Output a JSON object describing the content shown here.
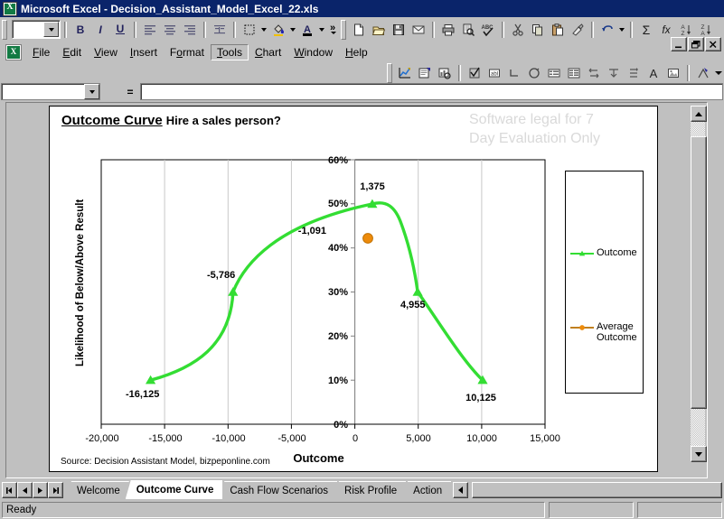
{
  "window": {
    "title": "Microsoft Excel - Decision_Assistant_Model_Excel_22.xls",
    "app_icon": "excel-logo-icon",
    "minimize_label": "_",
    "restore_label": "❐",
    "close_label": "✕"
  },
  "menu": {
    "items": [
      {
        "label": "File",
        "key": "F"
      },
      {
        "label": "Edit",
        "key": "E"
      },
      {
        "label": "View",
        "key": "V"
      },
      {
        "label": "Insert",
        "key": "I"
      },
      {
        "label": "Format",
        "key": "o"
      },
      {
        "label": "Tools",
        "key": "T",
        "selected": true
      },
      {
        "label": "Chart",
        "key": "C"
      },
      {
        "label": "Window",
        "key": "W"
      },
      {
        "label": "Help",
        "key": "H"
      }
    ]
  },
  "formatting_toolbar": {
    "font_size_value": "",
    "buttons": [
      "bold",
      "italic",
      "underline",
      "align-left",
      "align-center",
      "align-right",
      "merge-center",
      "borders",
      "fill-color",
      "font-color",
      "more-buttons"
    ]
  },
  "standard_toolbar": {
    "buttons": [
      "new",
      "open",
      "save",
      "email",
      "print",
      "print-preview",
      "spelling",
      "cut",
      "copy",
      "paste",
      "format-painter",
      "undo",
      "autosum",
      "paste-function",
      "sort-ascending",
      "sort-descending",
      "more-buttons"
    ]
  },
  "chart_toolbar": {
    "buttons": [
      "chart-objects",
      "format-object",
      "chart-type",
      "check-box",
      "text-box",
      "option-button",
      "list-box",
      "combo-box",
      "group-box",
      "scroll-bar",
      "spinner",
      "label",
      "image",
      "drawing",
      "more-buttons"
    ]
  },
  "formula_bar": {
    "name_box_value": "",
    "equals_label": "=",
    "formula_value": ""
  },
  "chart": {
    "title_main": "Outcome Curve",
    "title_sub": "Hire a sales person?",
    "watermark_line1": "Software legal for 7",
    "watermark_line2": "Day Evaluation Only",
    "source": "Source: Decision Assistant Model, bizpeponline.com",
    "legend_items": [
      {
        "label": "Outcome",
        "color": "#33DD33",
        "marker": "triangle"
      },
      {
        "label": "Average Outcome",
        "color": "#ED8B0B",
        "marker": "circle"
      }
    ]
  },
  "chart_data": {
    "type": "line",
    "title": "Outcome Curve  Hire a sales person?",
    "xlabel": "Outcome",
    "ylabel": "Likelihood of Below/Above Result",
    "xlim": [
      -20000,
      15000
    ],
    "ylim": [
      0,
      0.6
    ],
    "xticks": [
      -20000,
      -15000,
      -10000,
      -5000,
      0,
      5000,
      10000,
      15000
    ],
    "xticklabels": [
      "-20,000",
      "-15,000",
      "-10,000",
      "-5,000",
      "0",
      "5,000",
      "10,000",
      "15,000"
    ],
    "yticks": [
      0,
      0.1,
      0.2,
      0.3,
      0.4,
      0.5,
      0.6
    ],
    "yticklabels": [
      "0%",
      "10%",
      "20%",
      "30%",
      "40%",
      "50%",
      "60%"
    ],
    "grid": "vertical",
    "legend_position": "right",
    "series": [
      {
        "name": "Outcome",
        "color": "#33DD33",
        "marker": "triangle",
        "x": [
          -16125,
          -5786,
          1375,
          4955,
          10125
        ],
        "y": [
          0.1,
          0.3,
          0.5,
          0.3,
          0.1
        ],
        "point_labels": [
          "-16,125",
          "-5,786",
          "1,375",
          "4,955",
          "10,125"
        ]
      },
      {
        "name": "Average Outcome",
        "color": "#ED8B0B",
        "marker": "circle",
        "x": [
          -1091
        ],
        "y": [
          0.425
        ],
        "point_labels": [
          "-1,091"
        ]
      }
    ]
  },
  "sheet_tabs": {
    "first_label": "◀❙",
    "prev_label": "◀",
    "next_label": "▶",
    "last_label": "❙▶",
    "items": [
      {
        "label": "Welcome",
        "active": false
      },
      {
        "label": "Outcome Curve",
        "active": true
      },
      {
        "label": "Cash Flow Scenarios",
        "active": false
      },
      {
        "label": "Risk Profile",
        "active": false
      },
      {
        "label": "Action",
        "active": false
      }
    ]
  },
  "status_bar": {
    "message": "Ready",
    "pane2": "",
    "pane3": ""
  }
}
